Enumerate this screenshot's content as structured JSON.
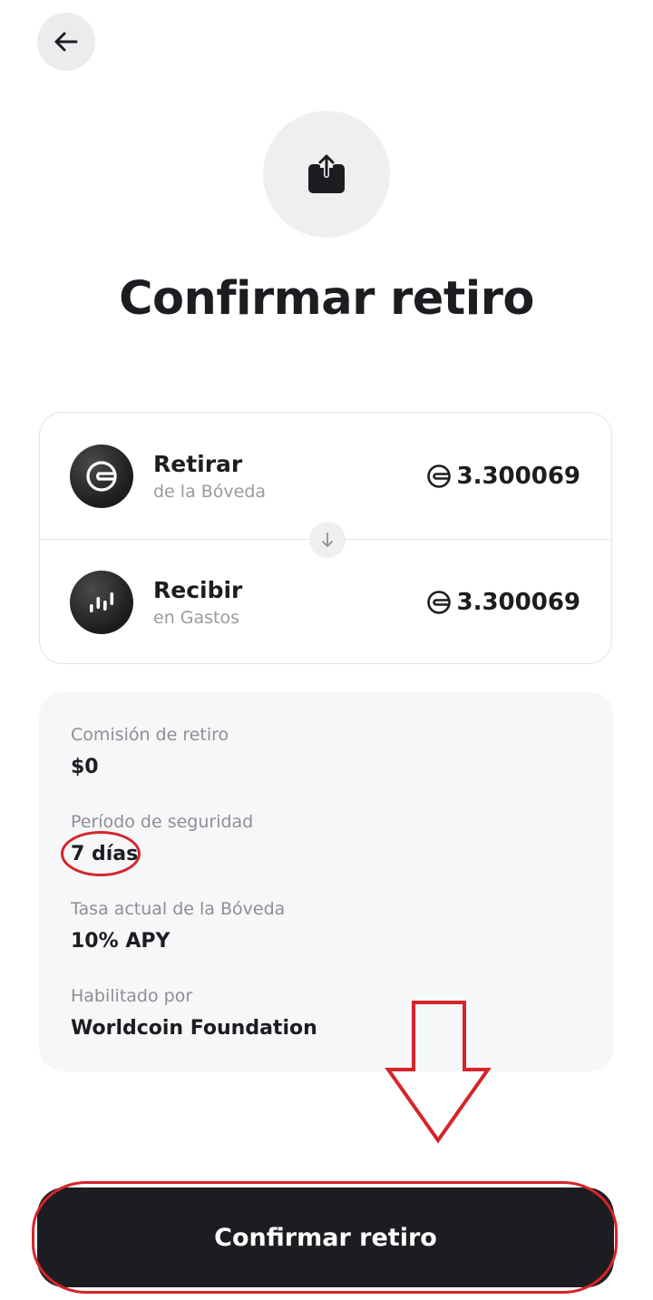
{
  "header": {
    "back_icon": "arrow-left-icon"
  },
  "hero": {
    "icon": "export-tray-icon"
  },
  "title": "Confirmar retiro",
  "transfer": {
    "from": {
      "label": "Retirar",
      "sublabel": "de la Bóveda",
      "amount": "3.300069",
      "token_icon": "worldcoin-icon"
    },
    "to": {
      "label": "Recibir",
      "sublabel": "en Gastos",
      "amount": "3.300069",
      "token_icon": "bar-chart-icon"
    },
    "arrow_icon": "arrow-down-icon"
  },
  "details": [
    {
      "label": "Comisión de retiro",
      "value": "$0"
    },
    {
      "label": "Período de seguridad",
      "value": "7 días"
    },
    {
      "label": "Tasa actual de la Bóveda",
      "value": "10% APY"
    },
    {
      "label": "Habilitado por",
      "value": "Worldcoin Foundation"
    }
  ],
  "confirm_button": {
    "label": "Confirmar retiro"
  },
  "colors": {
    "primary": "#1c1d21",
    "annotation": "#d6242b",
    "muted": "#9a9aa0",
    "card_bg": "#f6f7f8"
  }
}
